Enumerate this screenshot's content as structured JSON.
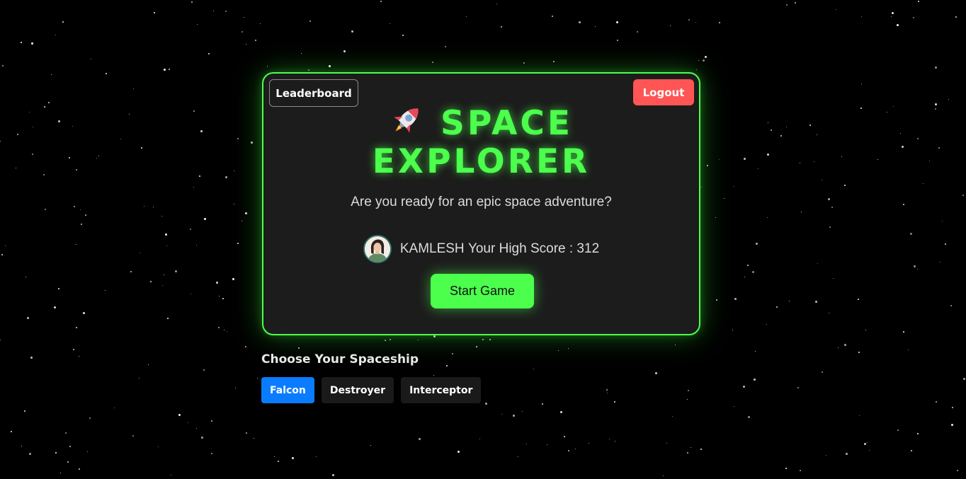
{
  "header": {
    "leaderboard_label": "Leaderboard",
    "logout_label": "Logout"
  },
  "hero": {
    "icon": "rocket-icon",
    "title_line1": "SPACE",
    "title_line2": "EXPLORER",
    "subtitle": "Are you ready for an epic space adventure?"
  },
  "player": {
    "name": "KAMLESH",
    "score_text": "Your High Score : 312",
    "avatar_icon": "user-avatar"
  },
  "start_label": "Start Game",
  "spaceships": {
    "title": "Choose Your Spaceship",
    "options": [
      {
        "label": "Falcon",
        "selected": true
      },
      {
        "label": "Destroyer",
        "selected": false
      },
      {
        "label": "Interceptor",
        "selected": false
      }
    ]
  },
  "colors": {
    "accent": "#4cff4c",
    "logout": "#ff5555",
    "selected": "#0a7cff",
    "card_bg": "#1c1c1c"
  }
}
